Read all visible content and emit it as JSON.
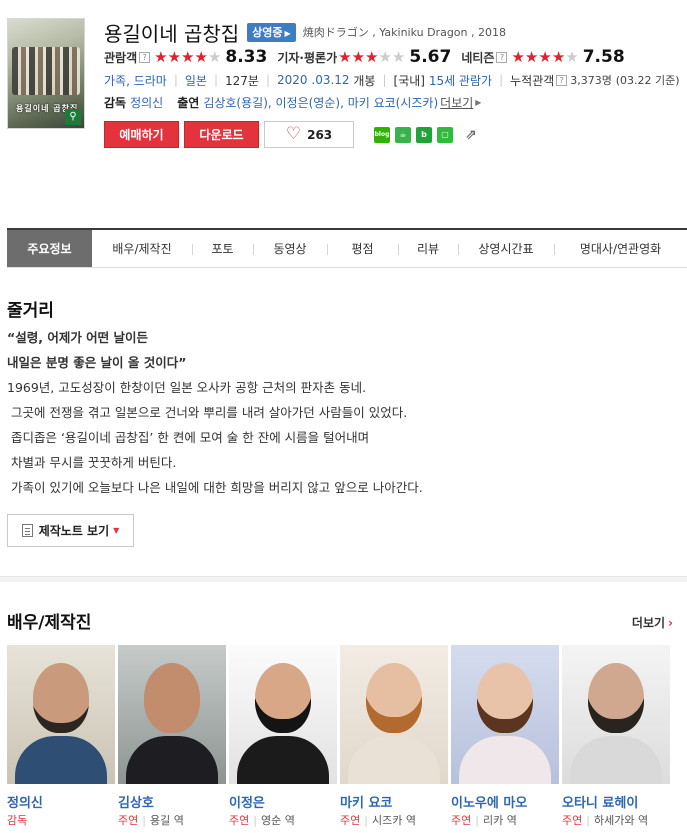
{
  "movie": {
    "title": "용길이네 곱창집",
    "status_badge": "상영중",
    "original_title": "焼肉ドラゴン , Yakiniku Dragon , 2018",
    "poster_title": "용길이네 곱창집",
    "ratings": [
      {
        "label": "관람객",
        "stars": 4,
        "score": "8.33"
      },
      {
        "label": "기자·평론가",
        "stars": 3,
        "score": "5.67"
      },
      {
        "label": "네티즌",
        "stars": 4,
        "score": "7.58"
      }
    ],
    "genres": "가족, 드라마",
    "country": "일본",
    "runtime": "127분",
    "release_date": "2020 .03.12",
    "release_suffix": "개봉",
    "domestic_label": "[국내]",
    "age_rating": "15세 관람가",
    "cumulative_label": "누적관객",
    "cumulative_value": "3,373명",
    "cumulative_date": "(03.22 기준)",
    "director_label": "감독",
    "director": "정의신",
    "cast_label": "출연",
    "cast_text": "김상호(용길), 이정은(영순), 마키 요코(시즈카)",
    "cast_more": "더보기"
  },
  "buttons": {
    "reserve": "예매하기",
    "download": "다운로드",
    "like_count": "263"
  },
  "share": {
    "blog": "blog",
    "cafe": "☕",
    "band": "b",
    "line": "▢",
    "share": "⇗"
  },
  "tabs": [
    "주요정보",
    "배우/제작진",
    "포토",
    "동영상",
    "평점",
    "리뷰",
    "상영시간표",
    "명대사/연관영화"
  ],
  "synopsis": {
    "heading": "줄거리",
    "quote1": "“설령, 어제가 어떤 날이든",
    "quote2": "내일은 분명 좋은 날이 올 것이다”",
    "lines": [
      "1969년, 고도성장이 한창이던 일본 오사카 공항 근처의 판자촌 동네.",
      " 그곳에 전쟁을 겪고 일본으로 건너와 뿌리를 내려 살아가던 사람들이 있었다.",
      " 좁디좁은 ‘용길이네 곱창집’ 한 켠에 모여 술 한 잔에 시름을 털어내며",
      " 차별과 무시를 꿋꿋하게 버틴다.",
      " 가족이 있기에 오늘보다 나은 내일에 대한 희망을 버리지 않고 앞으로 나아간다."
    ],
    "notes_button": "제작노트 보기"
  },
  "cast_section": {
    "heading": "배우/제작진",
    "more": "더보기",
    "people": [
      {
        "name": "정의신",
        "role_type": "감독",
        "role_name": ""
      },
      {
        "name": "김상호",
        "role_type": "주연",
        "role_name": "용길 역"
      },
      {
        "name": "이정은",
        "role_type": "주연",
        "role_name": "영순 역"
      },
      {
        "name": "마키 요코",
        "role_type": "주연",
        "role_name": "시즈카 역"
      },
      {
        "name": "이노우에 마오",
        "role_type": "주연",
        "role_name": "리카 역"
      },
      {
        "name": "오타니 료헤이",
        "role_type": "주연",
        "role_name": "하세가와 역"
      }
    ]
  },
  "colors": {
    "accent_red": "#e3343e",
    "link_blue": "#2e66b4",
    "badge_blue": "#3e7cc4",
    "tab_active": "#6d6d6d"
  }
}
